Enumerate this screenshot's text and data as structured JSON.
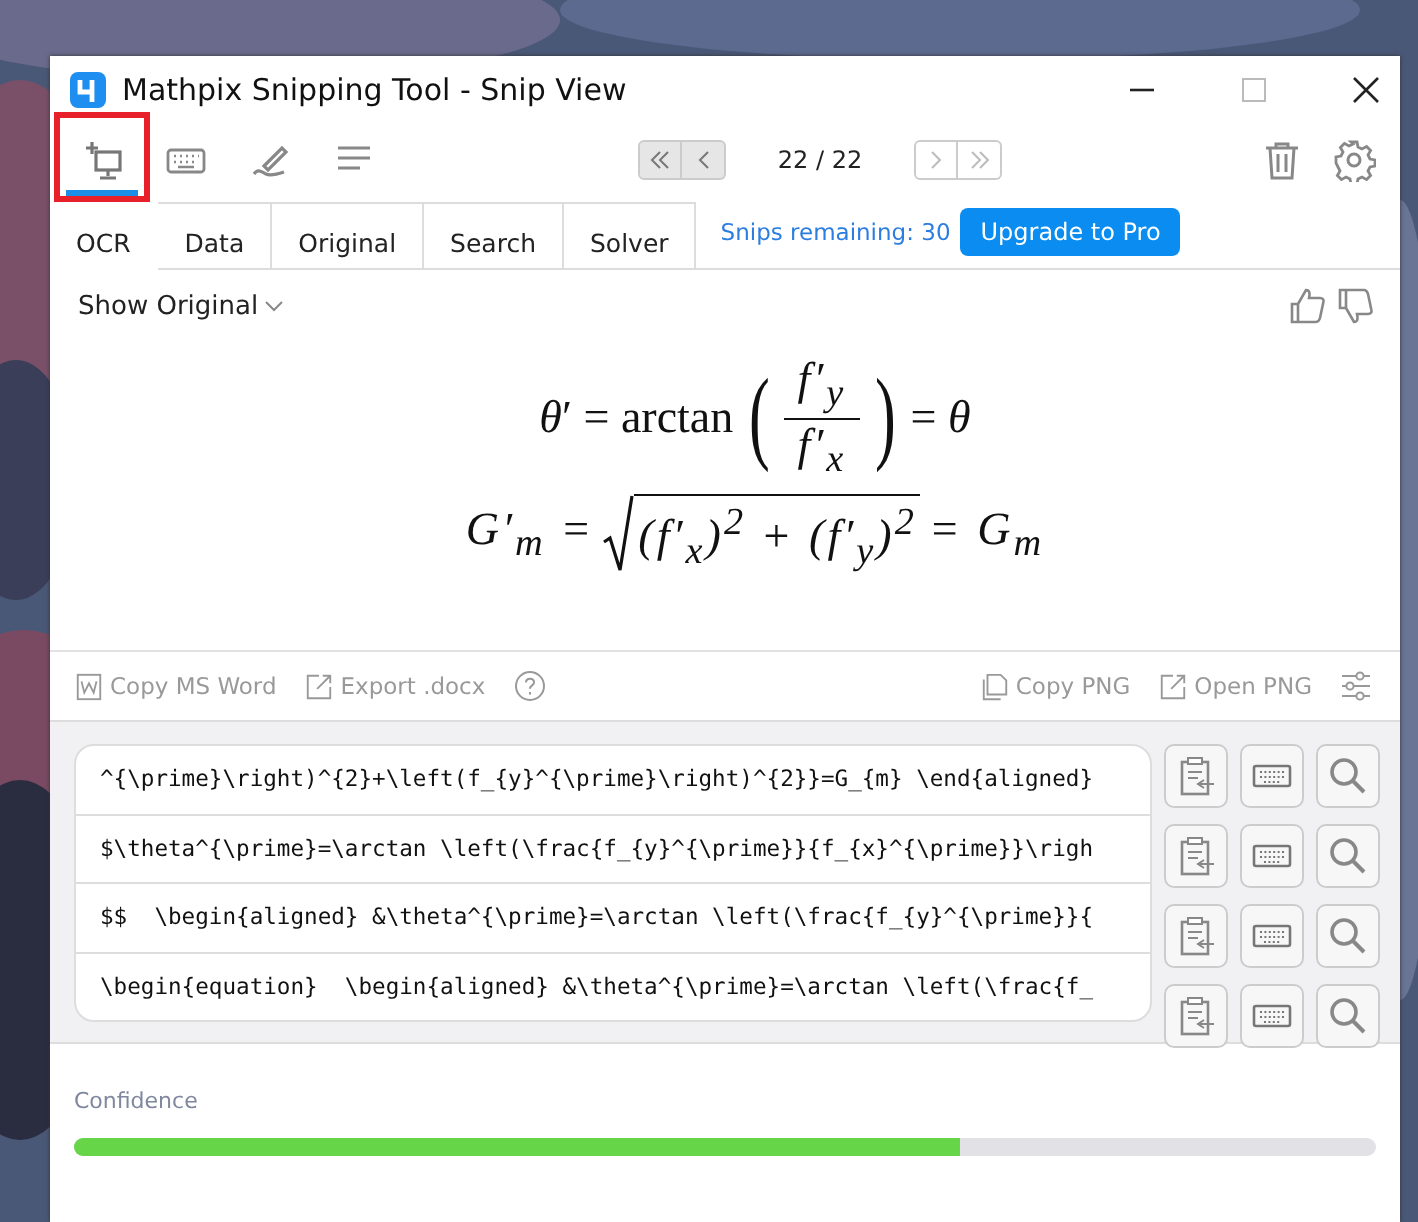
{
  "window": {
    "title": "Mathpix Snipping Tool - Snip View"
  },
  "tools": [
    {
      "kind": "snip",
      "selected": true
    },
    {
      "kind": "keyboard",
      "selected": false
    },
    {
      "kind": "pen",
      "selected": false
    },
    {
      "kind": "lines",
      "selected": false
    }
  ],
  "nav": {
    "counter": "22 / 22",
    "buttons": [
      {
        "kind": "first",
        "disabled": false
      },
      {
        "kind": "prev",
        "disabled": false
      },
      {
        "kind": "next",
        "disabled": true
      },
      {
        "kind": "last",
        "disabled": true
      }
    ]
  },
  "tabs": [
    {
      "label": "OCR",
      "selected": true
    },
    {
      "label": "Data",
      "selected": false
    },
    {
      "label": "Original",
      "selected": false
    },
    {
      "label": "Search",
      "selected": false
    },
    {
      "label": "Solver",
      "selected": false
    }
  ],
  "snips_remaining": "Snips remaining: 30",
  "upgrade_button": "Upgrade to Pro",
  "show_original": "Show Original",
  "formula": {
    "line1": {
      "lhs": "*θ*′ = arctan",
      "open": "(",
      "numerator": "f′$_{y}$",
      "denominator": "f′$_{x}$",
      "close": ")",
      "rhs": "= *θ*"
    },
    "line2": {
      "lhs": "G′$_{m}$ =",
      "radicand": "(f′$_{x}$)$^{2}$ + (f′$_{y}$)$^{2}$",
      "rhs": "= G$_{m}$"
    }
  },
  "actions_left": [
    {
      "kind": "word",
      "label": "Copy MS Word"
    },
    {
      "kind": "export",
      "label": "Export .docx"
    },
    {
      "kind": "help"
    }
  ],
  "actions_right": [
    {
      "kind": "copy",
      "label": "Copy PNG"
    },
    {
      "kind": "export",
      "label": "Open PNG"
    },
    {
      "kind": "sliders"
    }
  ],
  "codes": [
    "^{\\prime}\\right)^{2}+\\left(f_{y}^{\\prime}\\right)^{2}}=G_{m} \\end{aligned}",
    "$\\theta^{\\prime}=\\arctan \\left(\\frac{f_{y}^{\\prime}}{f_{x}^{\\prime}}\\righ",
    "$$  \\begin{aligned} &\\theta^{\\prime}=\\arctan \\left(\\frac{f_{y}^{\\prime}}{",
    "\\begin{equation}  \\begin{aligned} &\\theta^{\\prime}=\\arctan \\left(\\frac{f_"
  ],
  "confidence": {
    "label": "Confidence",
    "level": 0.68
  }
}
